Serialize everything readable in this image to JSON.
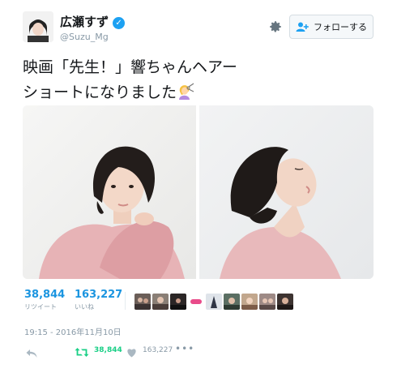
{
  "header": {
    "display_name": "広瀬すず",
    "handle": "@Suzu_Mg",
    "follow_label": "フォローする",
    "verified_mark": "✓"
  },
  "tweet": {
    "text_line1": "映画「先生！」響ちゃんヘアー",
    "text_line2": "ショートになりました",
    "emoji": "haircut-emoji"
  },
  "stats": {
    "retweets": "38,844",
    "retweets_label": "リツイート",
    "likes": "163,227",
    "likes_label": "いいね"
  },
  "timestamp": "19:15 - 2016年11月10日",
  "actions": {
    "retweet_count": "38,844",
    "like_count": "163,227",
    "more": "•••"
  },
  "icons": [
    "avatar-portrait",
    "gear-icon",
    "follow-person-icon",
    "reply-icon",
    "retweet-icon",
    "heart-icon",
    "more-icon"
  ],
  "colors": {
    "link_blue": "#1b95e0",
    "verified_blue": "#1da1f2",
    "retweet_green": "#19cf86",
    "muted": "#8899a6"
  }
}
